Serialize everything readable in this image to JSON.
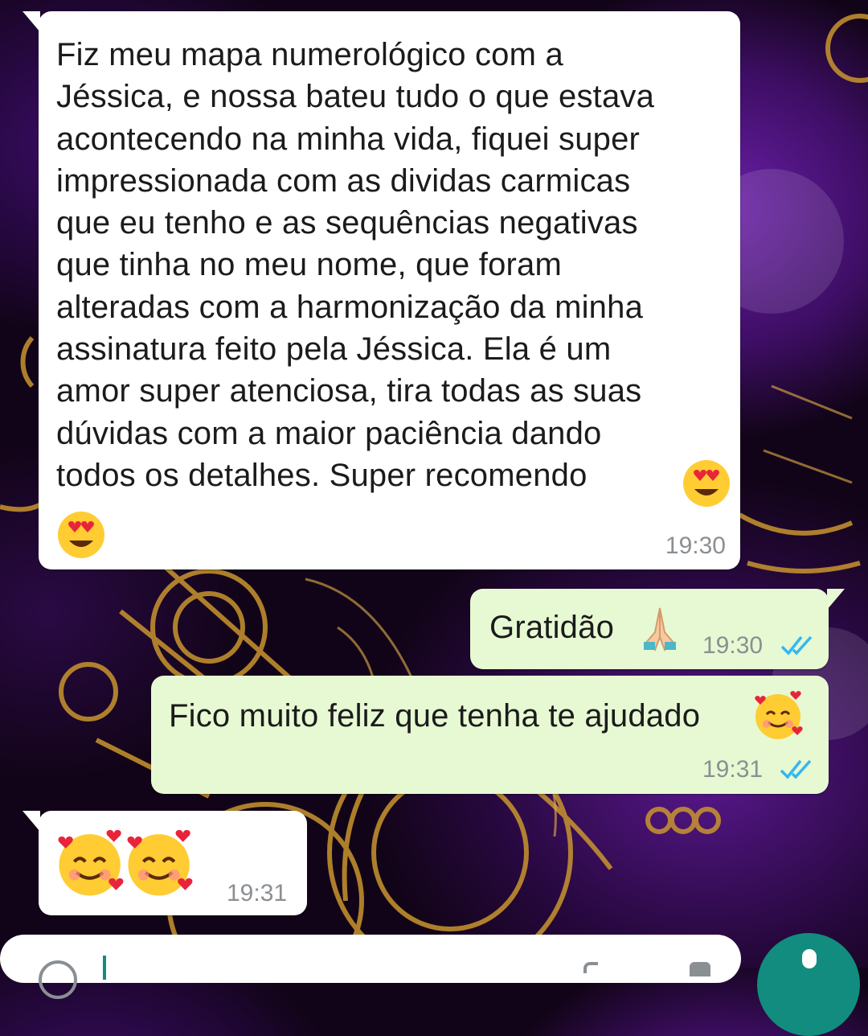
{
  "chat": {
    "messages": [
      {
        "direction": "incoming",
        "text": "Fiz meu mapa numerológico com a\nJéssica, e nossa bateu tudo o que estava\nacontecendo na minha vida, fiquei super\nimpressionada com as dividas  carmicas\nque eu tenho e as sequências negativas\nque tinha no meu nome, que foram\nalteradas com a harmonização da minha\nassinatura feito pela Jéssica. Ela é um\namor super atenciosa, tira todas as suas\ndúvidas com a maior paciência dando\ntodos os detalhes. Super recomendo",
        "emojis": [
          "heart-eyes",
          "heart-eyes"
        ],
        "time": "19:30"
      },
      {
        "direction": "outgoing",
        "text": "Gratidão",
        "emojis": [
          "folded-hands"
        ],
        "time": "19:30",
        "status": "read"
      },
      {
        "direction": "outgoing",
        "text": "Fico muito feliz que tenha te ajudado",
        "emojis": [
          "smiling-with-hearts"
        ],
        "time": "19:31",
        "status": "read"
      },
      {
        "direction": "incoming",
        "text": "",
        "emojis": [
          "smiling-with-hearts",
          "smiling-with-hearts"
        ],
        "time": "19:31"
      }
    ]
  },
  "colors": {
    "incoming_bubble": "#ffffff",
    "outgoing_bubble": "#e6f9d3",
    "read_ticks": "#34b7f1",
    "timestamp": "#8a8f93",
    "fab": "#128c7e"
  },
  "icons": {
    "read_receipt": "double-check-icon",
    "fab": "mic-icon"
  }
}
